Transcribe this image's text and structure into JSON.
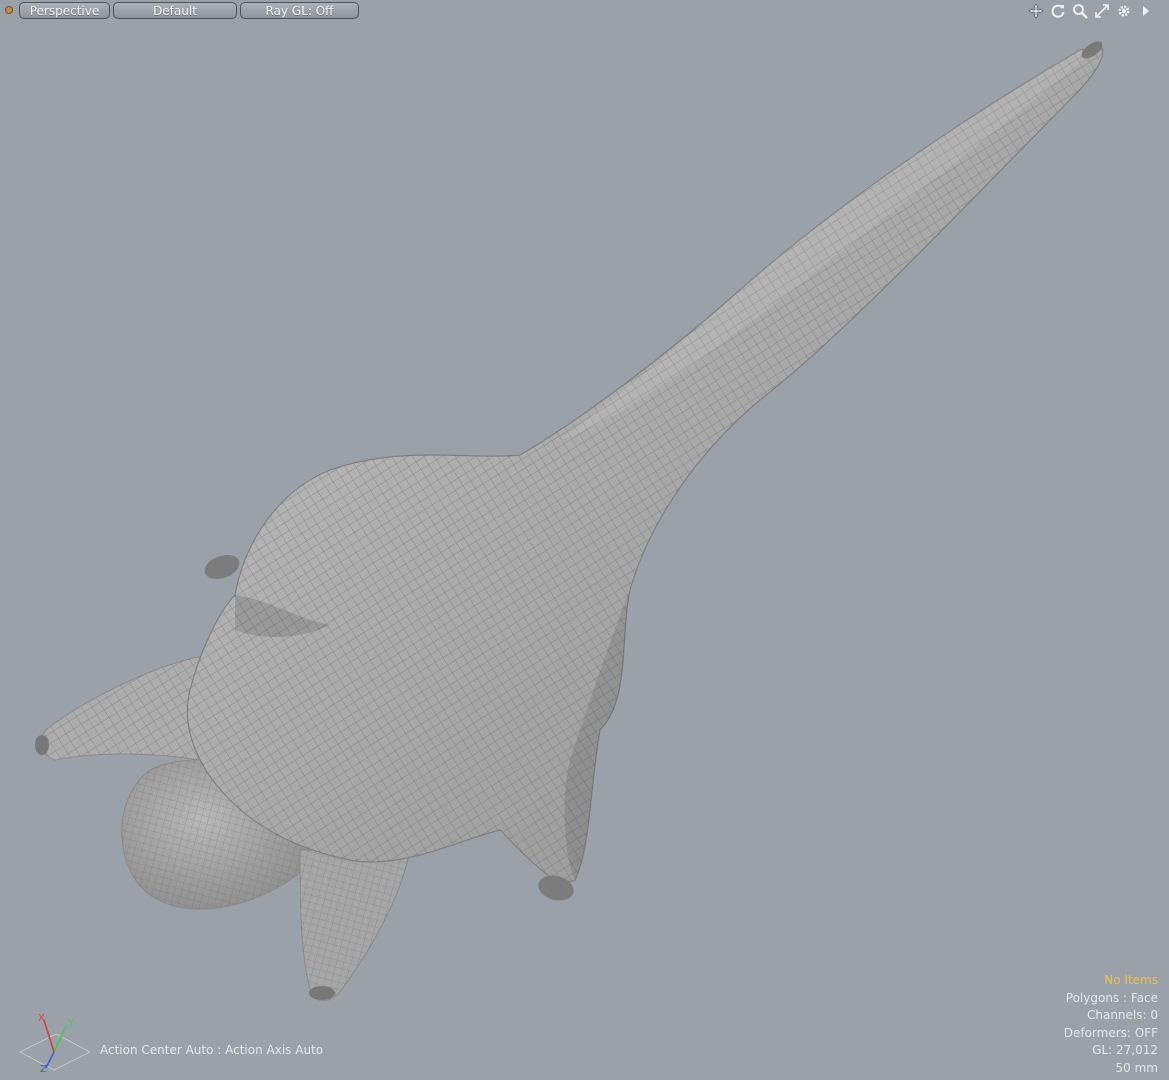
{
  "toolbar": {
    "view_label": "Perspective",
    "style_label": "Default",
    "raygl_label": "Ray GL: Off",
    "tools": [
      {
        "name": "move-view-icon"
      },
      {
        "name": "rotate-view-icon"
      },
      {
        "name": "zoom-view-icon"
      },
      {
        "name": "maximize-view-icon"
      },
      {
        "name": "settings-gear-icon"
      },
      {
        "name": "expand-arrow-icon"
      }
    ]
  },
  "status": {
    "action_center": "Action Center Auto : Action Axis Auto"
  },
  "info": {
    "items_label": "No Items",
    "polygons": "Polygons : Face",
    "channels": "Channels: 0",
    "deformers": "Deformers: OFF",
    "gl": "GL: 27,012",
    "lens": "50 mm"
  },
  "gizmo": {
    "x": "X",
    "y": "Y",
    "z": "Z"
  },
  "colors": {
    "background": "#9aa1a9",
    "highlight": "#f2c048",
    "mesh": "#9e9e9e",
    "wire": "#6f6f6f"
  }
}
